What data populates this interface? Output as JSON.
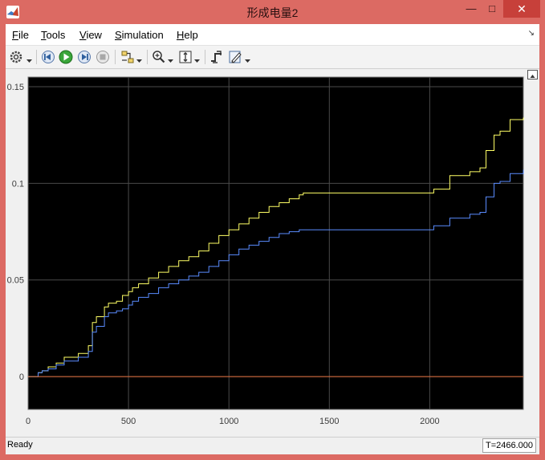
{
  "window": {
    "title": "形成电量2",
    "buttons": {
      "minimize": "—",
      "maximize": "□",
      "close": "✕"
    }
  },
  "menu": {
    "items": [
      {
        "label": "File",
        "accel": "F"
      },
      {
        "label": "Tools",
        "accel": "T"
      },
      {
        "label": "View",
        "accel": "V"
      },
      {
        "label": "Simulation",
        "accel": "S"
      },
      {
        "label": "Help",
        "accel": "H"
      }
    ],
    "overflow_icon": "dock-arrow-icon"
  },
  "toolbar": {
    "icons": [
      "gear-icon",
      "step-back-icon",
      "run-icon",
      "step-forward-icon",
      "stop-icon",
      "highlight-signal-icon",
      "zoom-icon",
      "fit-axes-icon",
      "trigger-icon",
      "style-icon"
    ]
  },
  "status": {
    "ready": "Ready",
    "time": "T=2466.000"
  },
  "chart_data": {
    "type": "line",
    "xlim": [
      0,
      2466
    ],
    "ylim": [
      -0.017,
      0.155
    ],
    "xticks": [
      0,
      500,
      1000,
      1500,
      2000
    ],
    "yticks": [
      0,
      0.05,
      0.1,
      0.15
    ],
    "xtick_labels": [
      "0",
      "500",
      "1000",
      "1500",
      "2000"
    ],
    "ytick_labels": [
      "0",
      "0.05",
      "0.1",
      "0.15"
    ],
    "grid": true,
    "background": "#000000",
    "axes_color": "#1e1e1e",
    "grid_color": "#4a4a4a",
    "series": [
      {
        "color": "#ffff66",
        "x": [
          0,
          40,
          50,
          70,
          100,
          140,
          180,
          250,
          300,
          320,
          340,
          380,
          400,
          440,
          470,
          500,
          520,
          550,
          600,
          650,
          700,
          750,
          800,
          850,
          900,
          950,
          1000,
          1050,
          1100,
          1150,
          1200,
          1250,
          1300,
          1350,
          1370,
          1400,
          1600,
          1800,
          2000,
          2020,
          2100,
          2200,
          2250,
          2280,
          2320,
          2350,
          2400,
          2466
        ],
        "y": [
          0,
          0,
          0.002,
          0.003,
          0.005,
          0.007,
          0.01,
          0.012,
          0.016,
          0.028,
          0.031,
          0.036,
          0.038,
          0.039,
          0.042,
          0.044,
          0.046,
          0.048,
          0.051,
          0.054,
          0.057,
          0.06,
          0.062,
          0.065,
          0.069,
          0.073,
          0.076,
          0.079,
          0.082,
          0.085,
          0.088,
          0.09,
          0.092,
          0.094,
          0.095,
          0.095,
          0.095,
          0.095,
          0.095,
          0.097,
          0.104,
          0.106,
          0.108,
          0.117,
          0.125,
          0.127,
          0.133,
          0.134
        ]
      },
      {
        "color": "#5a8cff",
        "x": [
          0,
          40,
          50,
          70,
          100,
          140,
          180,
          250,
          300,
          320,
          340,
          380,
          400,
          440,
          470,
          500,
          520,
          550,
          600,
          650,
          700,
          750,
          800,
          850,
          900,
          950,
          1000,
          1050,
          1100,
          1150,
          1200,
          1250,
          1300,
          1350,
          1370,
          1400,
          1600,
          1800,
          2000,
          2020,
          2100,
          2200,
          2250,
          2280,
          2320,
          2350,
          2400,
          2466
        ],
        "y": [
          0,
          0,
          0.002,
          0.003,
          0.004,
          0.006,
          0.008,
          0.01,
          0.013,
          0.023,
          0.026,
          0.031,
          0.033,
          0.034,
          0.035,
          0.037,
          0.039,
          0.041,
          0.043,
          0.046,
          0.048,
          0.05,
          0.052,
          0.054,
          0.057,
          0.06,
          0.063,
          0.066,
          0.068,
          0.07,
          0.072,
          0.074,
          0.075,
          0.076,
          0.076,
          0.076,
          0.076,
          0.076,
          0.076,
          0.078,
          0.082,
          0.084,
          0.085,
          0.093,
          0.1,
          0.101,
          0.105,
          0.107
        ]
      },
      {
        "color": "#e5703c",
        "x": [
          0,
          2466
        ],
        "y": [
          0,
          0
        ]
      }
    ]
  }
}
